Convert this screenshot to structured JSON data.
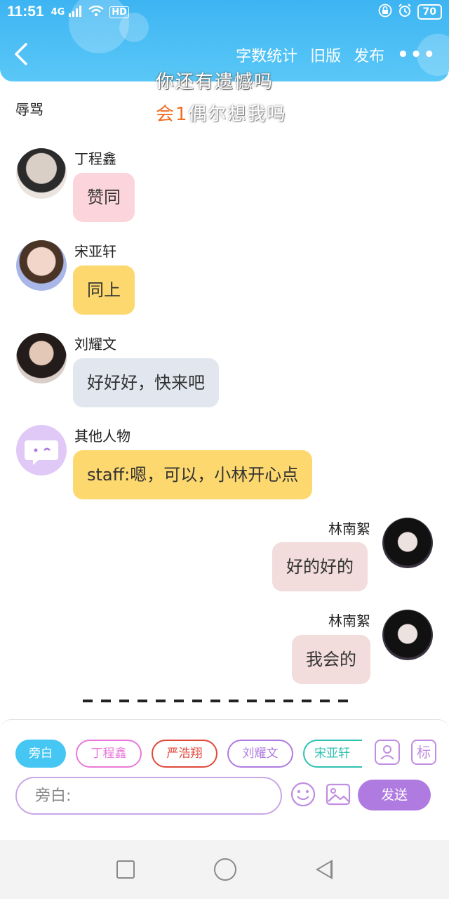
{
  "status_bar": {
    "time": "11:51",
    "signal": "4G",
    "hd": "HD",
    "battery": "70"
  },
  "header": {
    "actions": [
      "字数统计",
      "旧版",
      "发布"
    ],
    "more": "•••"
  },
  "overlay": {
    "line1": "你还有遗憾吗",
    "line2_accent": "会1",
    "line2_rest": "偶尔想我吗"
  },
  "section_label": "辱骂",
  "messages": [
    {
      "sender": "丁程鑫",
      "text": "赞同",
      "side": "left",
      "bubble_color": "#fcd5dc"
    },
    {
      "sender": "宋亚轩",
      "text": "同上",
      "side": "left",
      "bubble_color": "#fdd86e"
    },
    {
      "sender": "刘耀文",
      "text": "好好好，快来吧",
      "side": "left",
      "bubble_color": "#e2e7ef"
    },
    {
      "sender": "其他人物",
      "text": "staff:嗯，可以，小林开心点",
      "side": "left",
      "bubble_color": "#fdd86e"
    },
    {
      "sender": "林南絮",
      "text": "好的好的",
      "side": "right",
      "bubble_color": "#f2dcdc"
    },
    {
      "sender": "林南絮",
      "text": "我会的",
      "side": "right",
      "bubble_color": "#f2dcdc"
    }
  ],
  "input_panel": {
    "chips": [
      {
        "label": "旁白",
        "color": "#45c6f3",
        "selected": true
      },
      {
        "label": "丁程鑫",
        "color": "#e879d8",
        "selected": false
      },
      {
        "label": "严浩翔",
        "color": "#e0493b",
        "selected": false
      },
      {
        "label": "刘耀文",
        "color": "#b07be0",
        "selected": false
      },
      {
        "label": "宋亚轩",
        "color": "#2fc2b0",
        "selected": false
      }
    ],
    "tag_button": "标",
    "input_placeholder": "旁白:",
    "send_label": "发送"
  }
}
